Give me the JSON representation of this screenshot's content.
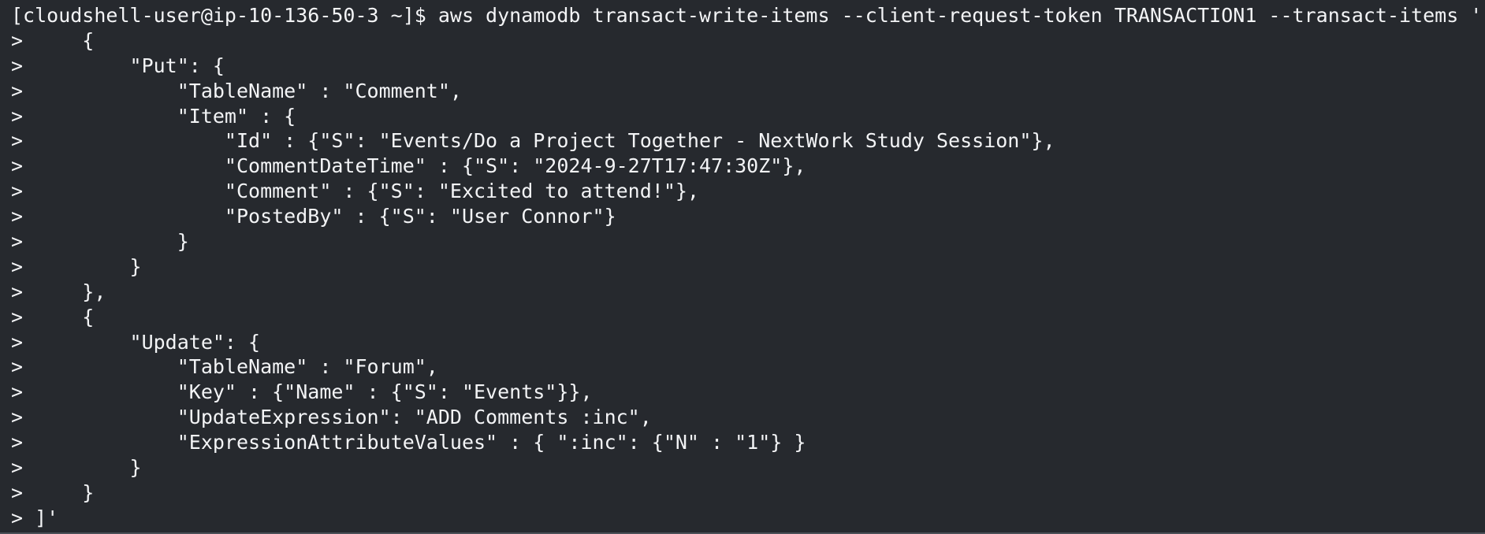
{
  "terminal": {
    "lines": [
      "[cloudshell-user@ip-10-136-50-3 ~]$ aws dynamodb transact-write-items --client-request-token TRANSACTION1 --transact-items '[",
      ">     {",
      ">         \"Put\": {",
      ">             \"TableName\" : \"Comment\",",
      ">             \"Item\" : {",
      ">                 \"Id\" : {\"S\": \"Events/Do a Project Together - NextWork Study Session\"},",
      ">                 \"CommentDateTime\" : {\"S\": \"2024-9-27T17:47:30Z\"},",
      ">                 \"Comment\" : {\"S\": \"Excited to attend!\"},",
      ">                 \"PostedBy\" : {\"S\": \"User Connor\"}",
      ">             }",
      ">         }",
      ">     },",
      ">     {",
      ">         \"Update\": {",
      ">             \"TableName\" : \"Forum\",",
      ">             \"Key\" : {\"Name\" : {\"S\": \"Events\"}},",
      ">             \"UpdateExpression\": \"ADD Comments :inc\",",
      ">             \"ExpressionAttributeValues\" : { \":inc\": {\"N\" : \"1\"} }",
      ">         }",
      ">     }",
      "> ]'"
    ]
  }
}
